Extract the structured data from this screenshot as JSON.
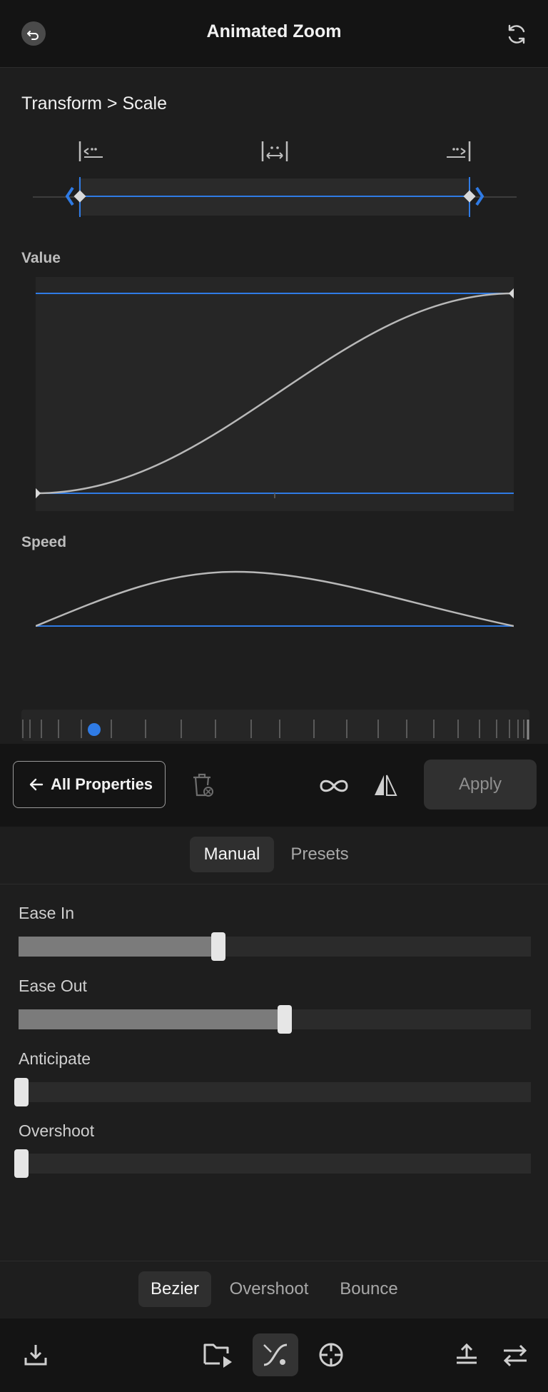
{
  "header": {
    "title": "Animated Zoom"
  },
  "breadcrumb": "Transform > Scale",
  "graphs": {
    "value_label": "Value",
    "speed_label": "Speed"
  },
  "action_bar": {
    "all_properties_label": "All Properties",
    "apply_label": "Apply"
  },
  "mode_tabs": [
    {
      "label": "Manual",
      "active": true
    },
    {
      "label": "Presets",
      "active": false
    }
  ],
  "sliders": [
    {
      "label": "Ease In",
      "value": 0.39
    },
    {
      "label": "Ease Out",
      "value": 0.52
    },
    {
      "label": "Anticipate",
      "value": 0.0
    },
    {
      "label": "Overshoot",
      "value": 0.0
    }
  ],
  "curve_tabs": [
    {
      "label": "Bezier",
      "active": true
    },
    {
      "label": "Overshoot",
      "active": false
    },
    {
      "label": "Bounce",
      "active": false
    }
  ],
  "colors": {
    "accent": "#2f7be5",
    "curve": "#b8b8b8"
  },
  "icons": {
    "header": [
      "back-icon",
      "refresh-icon"
    ],
    "trim": [
      "trim-start-icon",
      "trim-center-icon",
      "trim-end-icon"
    ],
    "action_bar": [
      "arrow-left-icon",
      "delete-keyframe-icon",
      "loop-icon",
      "mirror-icon"
    ],
    "bottom_bar": [
      "download-icon",
      "media-icon",
      "curve-icon",
      "target-icon",
      "export-icon",
      "swap-icon"
    ]
  }
}
